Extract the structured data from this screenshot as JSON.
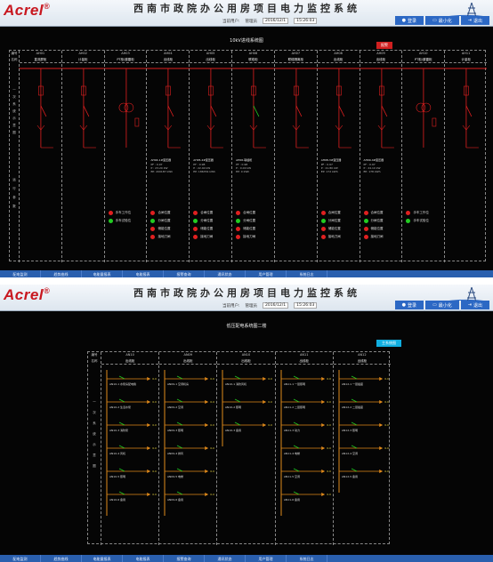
{
  "brand": {
    "logo": "Acrel",
    "mark": "®"
  },
  "header": {
    "title": "西南市政院办公用房项目电力监控系统",
    "user_label": "当前用户:",
    "user_name": "管理员",
    "date": "2016/12/1",
    "time": "15:26:03"
  },
  "header_buttons": {
    "login": "登录",
    "minimize": "最小化",
    "exit": "退出"
  },
  "nav": [
    "配电监测",
    "趋势曲线",
    "电能量报表",
    "电能报表",
    "报警查询",
    "通讯状态",
    "用户管理",
    "系统日志"
  ],
  "screen1": {
    "title": "10kV进线系统图",
    "alarm_btn": "报警",
    "row_labels": {
      "no": "编号",
      "name": "名称",
      "side": "一次系统示意图",
      "data": "运行参数"
    },
    "columns": [
      {
        "id": "AH01",
        "name": "直流屏柜",
        "type": "text"
      },
      {
        "id": "AH02",
        "name": "计量柜",
        "type": "text"
      },
      {
        "id": "AH03",
        "name": "PT柜/避雷柜",
        "type": "pt"
      },
      {
        "id": "AH04",
        "name": "出线柜",
        "type": "meter",
        "dtitle": "AH04-1#变压器",
        "pf": "0.97",
        "p": "23.20 kW",
        "ep": "200187 kWh"
      },
      {
        "id": "AH05",
        "name": "出线柜",
        "type": "meter",
        "dtitle": "AH05-2#变压器",
        "pf": "0.98",
        "p": "22.40 kW",
        "ep": "186354 kWh"
      },
      {
        "id": "AH06",
        "name": "联络柜",
        "type": "meter",
        "dtitle": "AH06-联络柜",
        "pf": "0.98",
        "p": "0.00 kW",
        "ep": "0 kWh"
      },
      {
        "id": "AH07",
        "name": "联络隔离柜",
        "type": "text"
      },
      {
        "id": "AH08",
        "name": "出线柜",
        "type": "meter",
        "dtitle": "AH08-3#变压器",
        "pf": "0.97",
        "p": "21.80 kW",
        "ep": "172 kWh"
      },
      {
        "id": "AH09",
        "name": "出线柜",
        "type": "meter",
        "dtitle": "AH09-4#变压器",
        "pf": "0.97",
        "p": "24.10 kW",
        "ep": "178 kWh"
      },
      {
        "id": "AH10",
        "name": "PT柜/避雷柜",
        "type": "pt"
      },
      {
        "id": "AH11",
        "name": "计量柜",
        "type": "text"
      }
    ],
    "status_labels": [
      "合闸位置",
      "分闸位置",
      "储能位置",
      "接地刀闸"
    ],
    "pt_labels": [
      "手车工作位",
      "手车试验位"
    ],
    "colors": {
      "on": "#e02020",
      "off": "#22cc22",
      "bus": "#e02020"
    }
  },
  "screen2": {
    "title": "低压配电系统图二楼",
    "btn": "主系统图",
    "row_labels": {
      "no": "编号",
      "name": "名称",
      "side": "一次系统示意图"
    },
    "columns": [
      {
        "id": "AN10",
        "name": "出线柜"
      },
      {
        "id": "AN09",
        "name": "出线柜"
      },
      {
        "id": "AN10",
        "name": "出线柜"
      },
      {
        "id": "AN11",
        "name": "出线柜"
      },
      {
        "id": "AN12",
        "name": "出线柜"
      }
    ],
    "feeders": [
      [
        "AN10-1 水泵房配电箱",
        "AN10-2 生活水泵",
        "AN10-3 消防泵",
        "AN10-4 风机",
        "AN10-5 照明",
        "AN10-6 备用"
      ],
      [
        "AN09-1 空调机房",
        "AN09-2 空调",
        "AN09-3 照明",
        "AN09-4 排风",
        "AN09-5 电梯",
        "AN09-6 备用"
      ],
      [
        "AN10-1 消防风机",
        "AN10-2 照明",
        "AN10-3 备用"
      ],
      [
        "AN11-1 一层照明",
        "AN11-2 二层照明",
        "AN11-3 动力",
        "AN11-4 电梯",
        "AN11-5 空调",
        "AN11-6 备用"
      ],
      [
        "AN12-1 一层插座",
        "AN12-2 二层插座",
        "AN12-3 照明",
        "AN12-4 空调",
        "AN12-5 备用"
      ]
    ]
  }
}
